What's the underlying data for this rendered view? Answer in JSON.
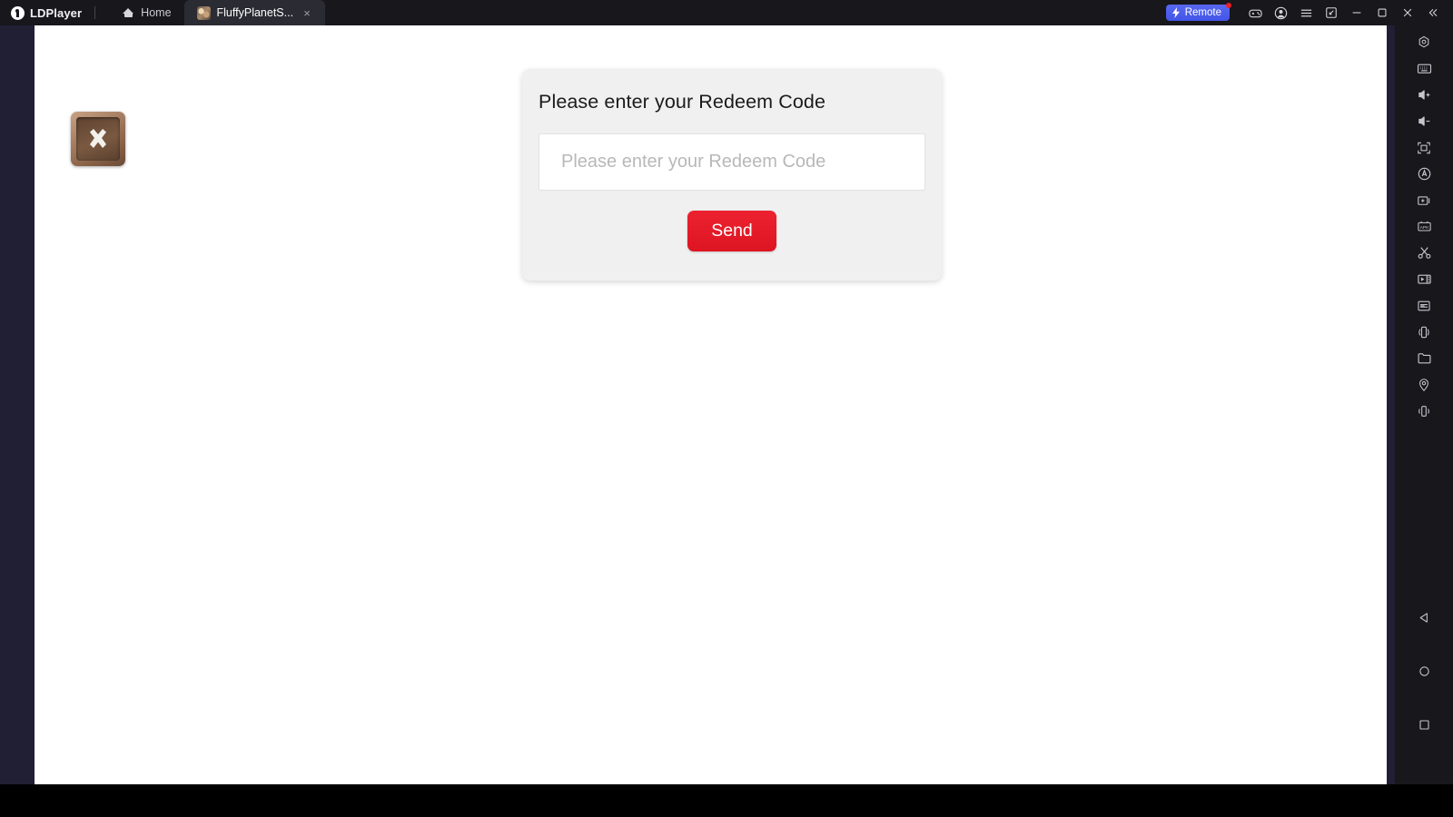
{
  "titlebar": {
    "brand": "LDPlayer",
    "tabs": [
      {
        "label": "Home",
        "icon": "home-icon",
        "active": false,
        "closable": false
      },
      {
        "label": "FluffyPlanetS...",
        "icon": "game-app-icon",
        "active": true,
        "closable": true,
        "close_glyph": "×"
      }
    ],
    "remote": {
      "label": "Remote",
      "icon": "lightning-bolt-icon",
      "has_badge": true,
      "color": "#4b5ae8",
      "badge_color": "#e8202a"
    },
    "right_icons": [
      {
        "name": "gamepad-icon",
        "title": "Gamepad"
      },
      {
        "name": "account-icon",
        "title": "Account"
      },
      {
        "name": "menu-icon",
        "title": "Menu"
      },
      {
        "name": "multi-instance-icon",
        "title": "Multi-Instance"
      },
      {
        "name": "minimize-icon",
        "title": "Minimize"
      },
      {
        "name": "maximize-icon",
        "title": "Maximize"
      },
      {
        "name": "close-icon",
        "title": "Close"
      },
      {
        "name": "collapse-sidebar-icon",
        "title": "Collapse"
      }
    ]
  },
  "emulator": {
    "background_color": "#201f33",
    "screen_color": "#ffffff",
    "game_close_button": {
      "name": "game-close-button",
      "glyph": "✕"
    }
  },
  "redeem_dialog": {
    "title": "Please enter your Redeem Code",
    "input_value": "",
    "input_placeholder": "Please enter your Redeem Code",
    "send_label": "Send",
    "send_color": "#e8202a",
    "card_color": "#f0f0f0"
  },
  "sidebar": {
    "top_items": [
      {
        "name": "settings-gear-icon",
        "label": "Settings"
      },
      {
        "name": "keyboard-icon",
        "label": "Keyboard Mapping"
      },
      {
        "name": "volume-up-icon",
        "label": "Volume Up"
      },
      {
        "name": "volume-down-icon",
        "label": "Volume Down"
      },
      {
        "name": "fullscreen-icon",
        "label": "Fullscreen"
      },
      {
        "name": "auto-rotate-icon",
        "label": "Auto Rotate"
      },
      {
        "name": "screenshot-icon",
        "label": "Screenshot"
      },
      {
        "name": "apk-install-icon",
        "label": "Install APK"
      },
      {
        "name": "scissors-icon",
        "label": "Cut"
      },
      {
        "name": "video-record-icon",
        "label": "Record"
      },
      {
        "name": "multi-window-icon",
        "label": "Multi Window"
      },
      {
        "name": "rotate-device-icon",
        "label": "Rotate"
      },
      {
        "name": "folder-icon",
        "label": "Shared Folder"
      },
      {
        "name": "location-icon",
        "label": "Location"
      },
      {
        "name": "shake-icon",
        "label": "Shake"
      }
    ],
    "bottom_items": [
      {
        "name": "android-back-icon",
        "label": "Back"
      },
      {
        "name": "android-home-icon",
        "label": "Home"
      },
      {
        "name": "android-recents-icon",
        "label": "Recents"
      }
    ]
  }
}
